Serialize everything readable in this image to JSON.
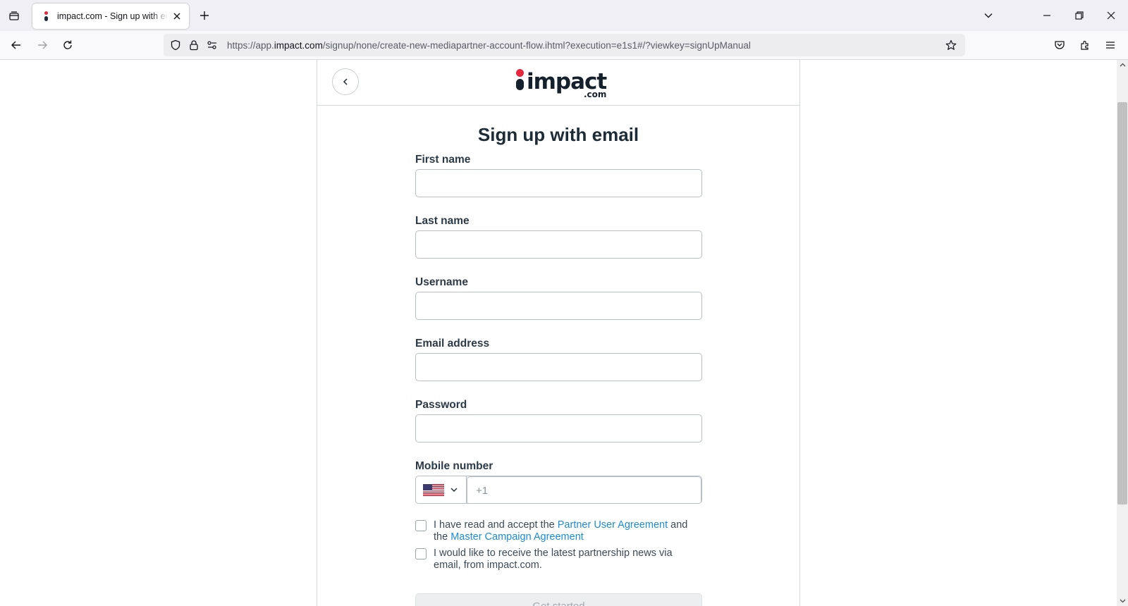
{
  "browser": {
    "tab_title": "impact.com - Sign up with email",
    "url_prefix": "https://app.",
    "url_host": "impact.com",
    "url_path": "/signup/none/create-new-mediapartner-account-flow.ihtml?execution=e1s1#/?viewkey=signUpManual"
  },
  "header": {
    "logo_word": "impact",
    "logo_suffix": ".com"
  },
  "form": {
    "title": "Sign up with email",
    "fields": [
      {
        "label": "First name",
        "value": ""
      },
      {
        "label": "Last name",
        "value": ""
      },
      {
        "label": "Username",
        "value": ""
      },
      {
        "label": "Email address",
        "value": ""
      },
      {
        "label": "Password",
        "value": ""
      }
    ],
    "mobile": {
      "label": "Mobile number",
      "country": "United States",
      "placeholder": "+1"
    },
    "agreement": {
      "text_1": "I have read and accept the",
      "link_1": "Partner User Agreement",
      "text_2": "and the",
      "link_2": "Master Campaign Agreement",
      "checked": false
    },
    "newsletter": {
      "text": "I would like to receive the latest partnership news via email, from impact.com.",
      "checked": false
    },
    "submit_label": "Get started"
  },
  "colors": {
    "brand_red": "#e8263d",
    "brand_dark": "#14202b",
    "link": "#1a8dd6"
  }
}
